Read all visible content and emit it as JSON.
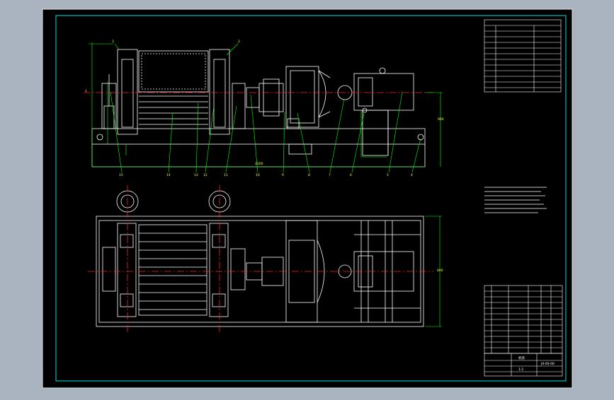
{
  "drawing": {
    "title_block": {
      "label_row1": "机架",
      "label_row2": "1:2",
      "drawing_number": "JX-00-00"
    },
    "part_numbers": [
      "15",
      "14",
      "13",
      "12",
      "11",
      "10",
      "9",
      "8",
      "7",
      "6",
      "5",
      "4",
      "3",
      "2",
      "1"
    ],
    "dimension_labels": {
      "overall_length": "2200",
      "height": "900",
      "width": "800"
    },
    "colors": {
      "background": "#000000",
      "frame": "#00ffff",
      "geometry": "#ffffff",
      "centerline": "#ff0000",
      "leader": "#00ff00",
      "label": "#ffff00"
    }
  }
}
